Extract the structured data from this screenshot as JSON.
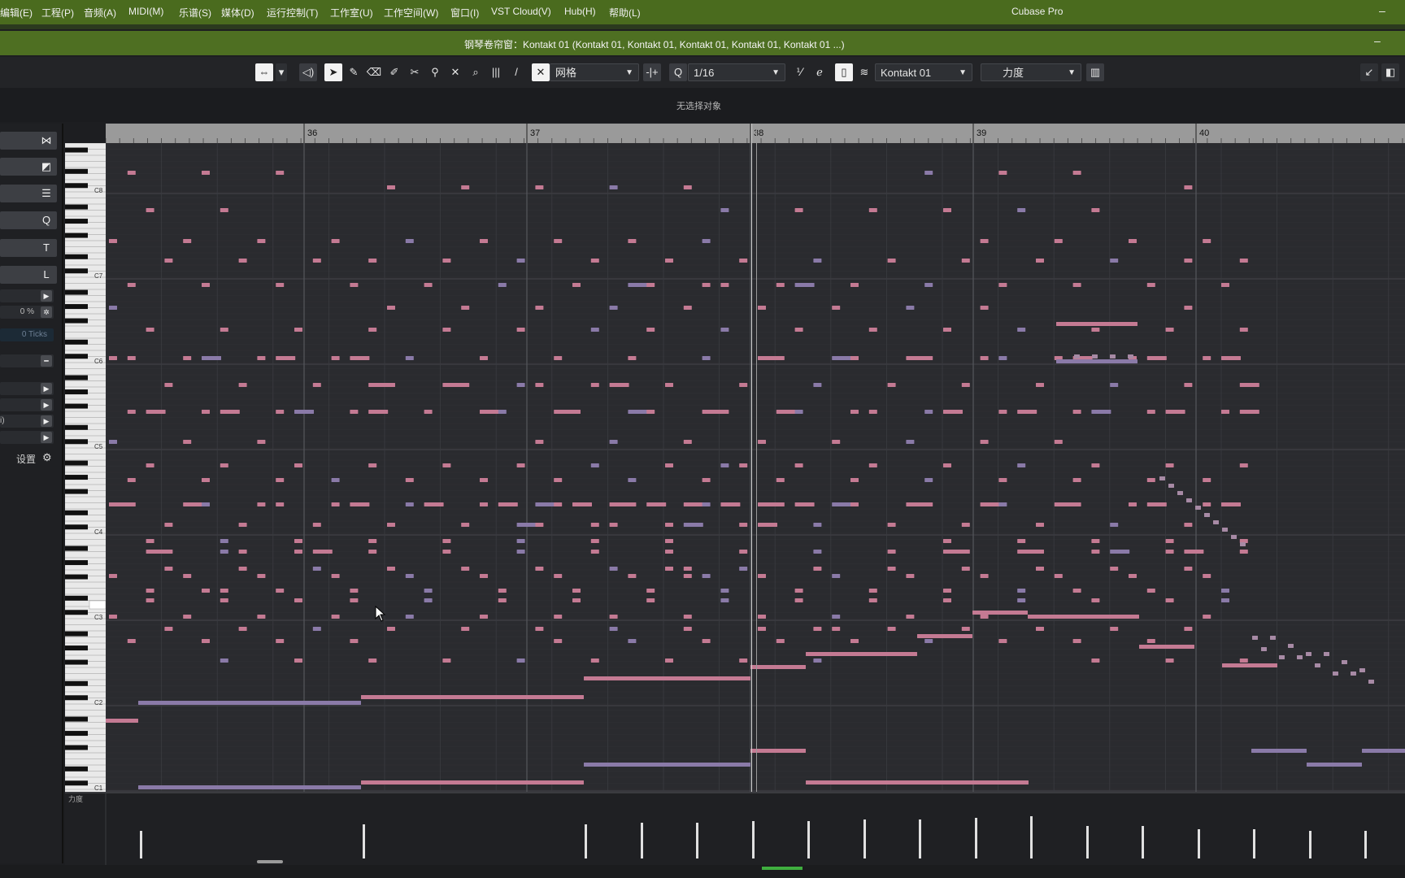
{
  "menubar": {
    "items": [
      "编辑(E)",
      "工程(P)",
      "音频(A)",
      "MIDI(M)",
      "乐谱(S)",
      "媒体(D)",
      "运行控制(T)",
      "工作室(U)",
      "工作空间(W)",
      "窗口(I)",
      "VST Cloud(V)",
      "Hub(H)",
      "帮助(L)"
    ],
    "app_title": "Cubase Pro",
    "minimize": "–"
  },
  "window": {
    "title": "钢琴卷帘窗：Kontakt 01 (Kontakt 01, Kontakt 01, Kontakt 01, Kontakt 01, Kontakt 01 ...)",
    "minimize": "–"
  },
  "toolbar": {
    "snap_type": "网格",
    "quantize": "1/16",
    "instrument": "Kontakt 01",
    "controller": "力度",
    "quantize_label": "Q"
  },
  "info": {
    "status": "无选择对象"
  },
  "inspector": {
    "transpose": "0 %",
    "ticks": "0 Ticks",
    "settings_label": "设置",
    "side_label": "i)"
  },
  "ruler": {
    "bars": [
      "36",
      "37",
      "38",
      "39",
      "40"
    ]
  },
  "keyboard": {
    "octaves": [
      "C8",
      "C7",
      "C6",
      "C5",
      "C4",
      "C3",
      "C2",
      "C1"
    ]
  },
  "velocity_lane": {
    "label": "力度"
  },
  "colors": {
    "menubar": "#4a6b1e",
    "titlebar": "#4e6f22",
    "note_pink": "#c47a93",
    "note_purple": "#8a7aa8",
    "grid_bg": "#2a2b2f"
  }
}
